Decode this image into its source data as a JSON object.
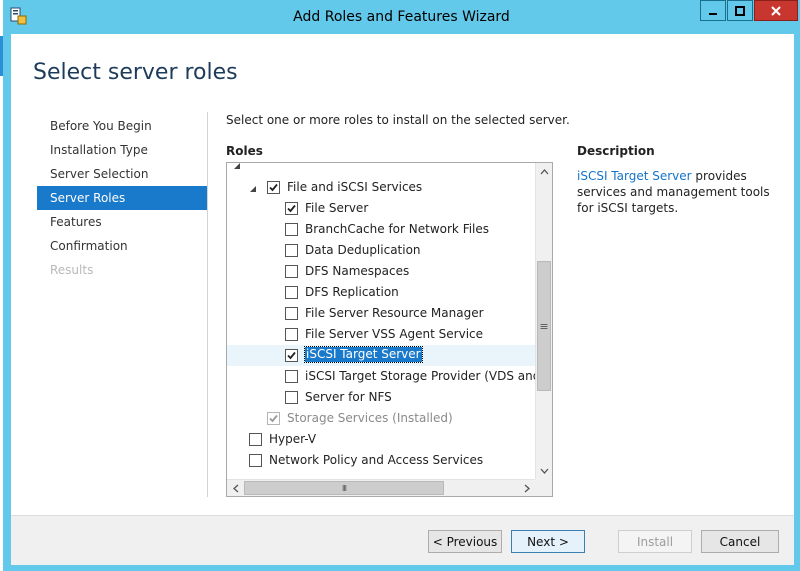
{
  "window": {
    "title": "Add Roles and Features Wizard"
  },
  "page": {
    "title": "Select server roles",
    "instruction": "Select one or more roles to install on the selected server.",
    "roles_heading": "Roles",
    "description_heading": "Description",
    "description_link": "iSCSI Target Server",
    "description_rest": " provides services and management tools for iSCSI targets."
  },
  "nav": {
    "items": [
      {
        "label": "Before You Begin",
        "state": "normal"
      },
      {
        "label": "Installation Type",
        "state": "normal"
      },
      {
        "label": "Server Selection",
        "state": "normal"
      },
      {
        "label": "Server Roles",
        "state": "active"
      },
      {
        "label": "Features",
        "state": "normal"
      },
      {
        "label": "Confirmation",
        "state": "normal"
      },
      {
        "label": "Results",
        "state": "disabled"
      }
    ]
  },
  "roles": {
    "items": [
      {
        "label": "File and iSCSI Services",
        "checked": true,
        "dim": false,
        "expander": "collapse"
      },
      {
        "label": "File Server",
        "checked": true,
        "dim": false
      },
      {
        "label": "BranchCache for Network Files",
        "checked": false,
        "dim": false
      },
      {
        "label": "Data Deduplication",
        "checked": false,
        "dim": false
      },
      {
        "label": "DFS Namespaces",
        "checked": false,
        "dim": false
      },
      {
        "label": "DFS Replication",
        "checked": false,
        "dim": false
      },
      {
        "label": "File Server Resource Manager",
        "checked": false,
        "dim": false
      },
      {
        "label": "File Server VSS Agent Service",
        "checked": false,
        "dim": false
      },
      {
        "label": "iSCSI Target Server",
        "checked": true,
        "dim": false,
        "selected": true
      },
      {
        "label": "iSCSI Target Storage Provider (VDS and VSS",
        "checked": false,
        "dim": false
      },
      {
        "label": "Server for NFS",
        "checked": false,
        "dim": false
      },
      {
        "label": "Storage Services (Installed)",
        "checked": true,
        "dim": true
      },
      {
        "label": "Hyper-V",
        "checked": false,
        "dim": false
      },
      {
        "label": "Network Policy and Access Services",
        "checked": false,
        "dim": false
      }
    ]
  },
  "buttons": {
    "previous": "< Previous",
    "next": "Next >",
    "install": "Install",
    "cancel": "Cancel"
  },
  "scrollbar": {
    "grip_glyph": "≡",
    "hgrip_glyph": "III"
  },
  "colors": {
    "titlebar": "#62c9ea",
    "active_nav": "#1979ca",
    "close_button": "#c7372f",
    "link": "#1573c8"
  }
}
